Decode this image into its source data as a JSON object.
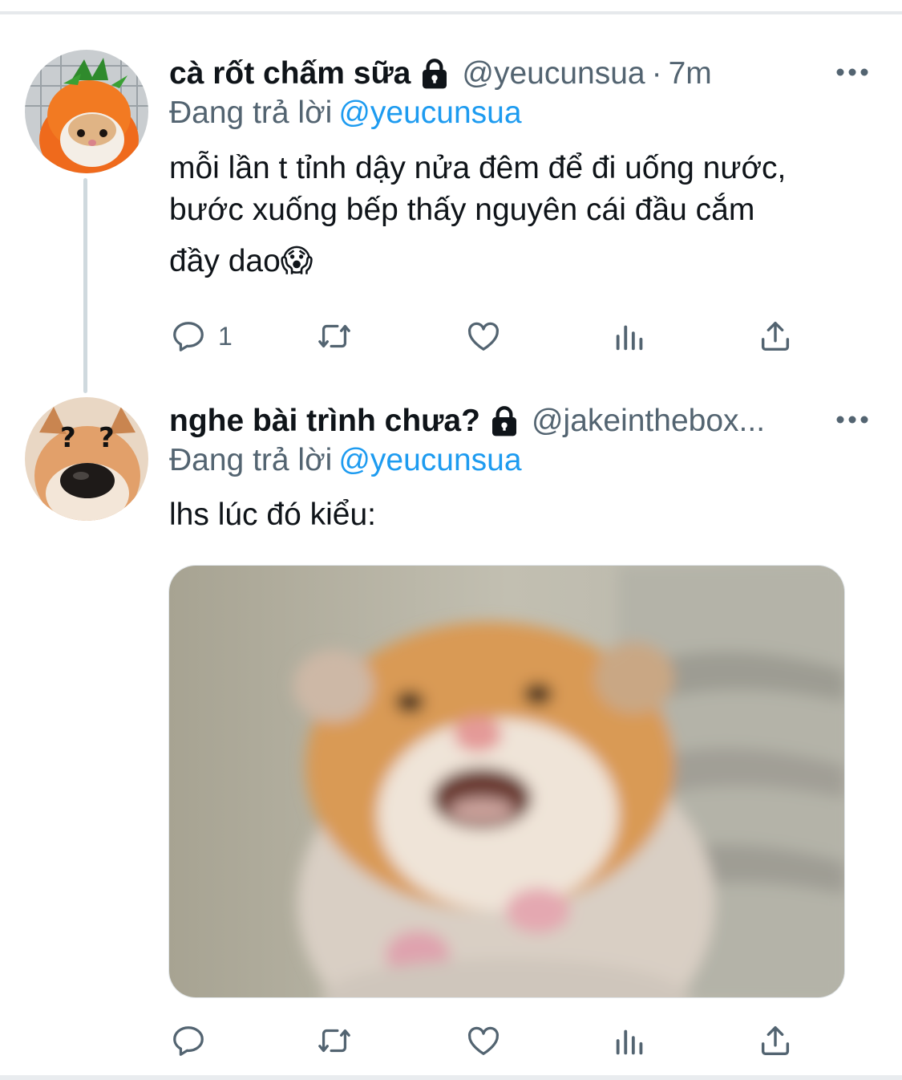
{
  "tweets": [
    {
      "display_name": "cà rốt chấm sữa",
      "handle": "@yeucunsua",
      "separator": "·",
      "time": "7m",
      "replying_label": "Đang trả lời",
      "replying_to": "@yeucunsua",
      "text_lines": [
        "mỗi lần t tỉnh dậy nửa đêm để đi uống nước,",
        "bước xuống bếp thấy nguyên cái đầu cắm",
        "đầy dao😱"
      ],
      "reply_count": "1",
      "avatar": "hamster-in-carrot-hat",
      "icons": [
        "lock-icon",
        "more-icon",
        "reply-icon",
        "retweet-icon",
        "like-icon",
        "analytics-icon",
        "share-icon"
      ]
    },
    {
      "display_name": "nghe bài trình chưa?",
      "handle": "@jakeintheboх...",
      "replying_label": "Đang trả lời",
      "replying_to": "@yeucunsua",
      "text_lines": [
        "lhs lúc đó kiểu:"
      ],
      "avatar": "shiba-with-question-marks",
      "avatar_marks": "? ?",
      "media": "scared-hamster-photo",
      "icons": [
        "lock-icon",
        "more-icon",
        "reply-icon",
        "retweet-icon",
        "like-icon",
        "analytics-icon",
        "share-icon"
      ]
    }
  ],
  "colors": {
    "text": "#0f1419",
    "secondary": "#536471",
    "link": "#1d9bf0",
    "thread_line": "#cfd9de"
  }
}
